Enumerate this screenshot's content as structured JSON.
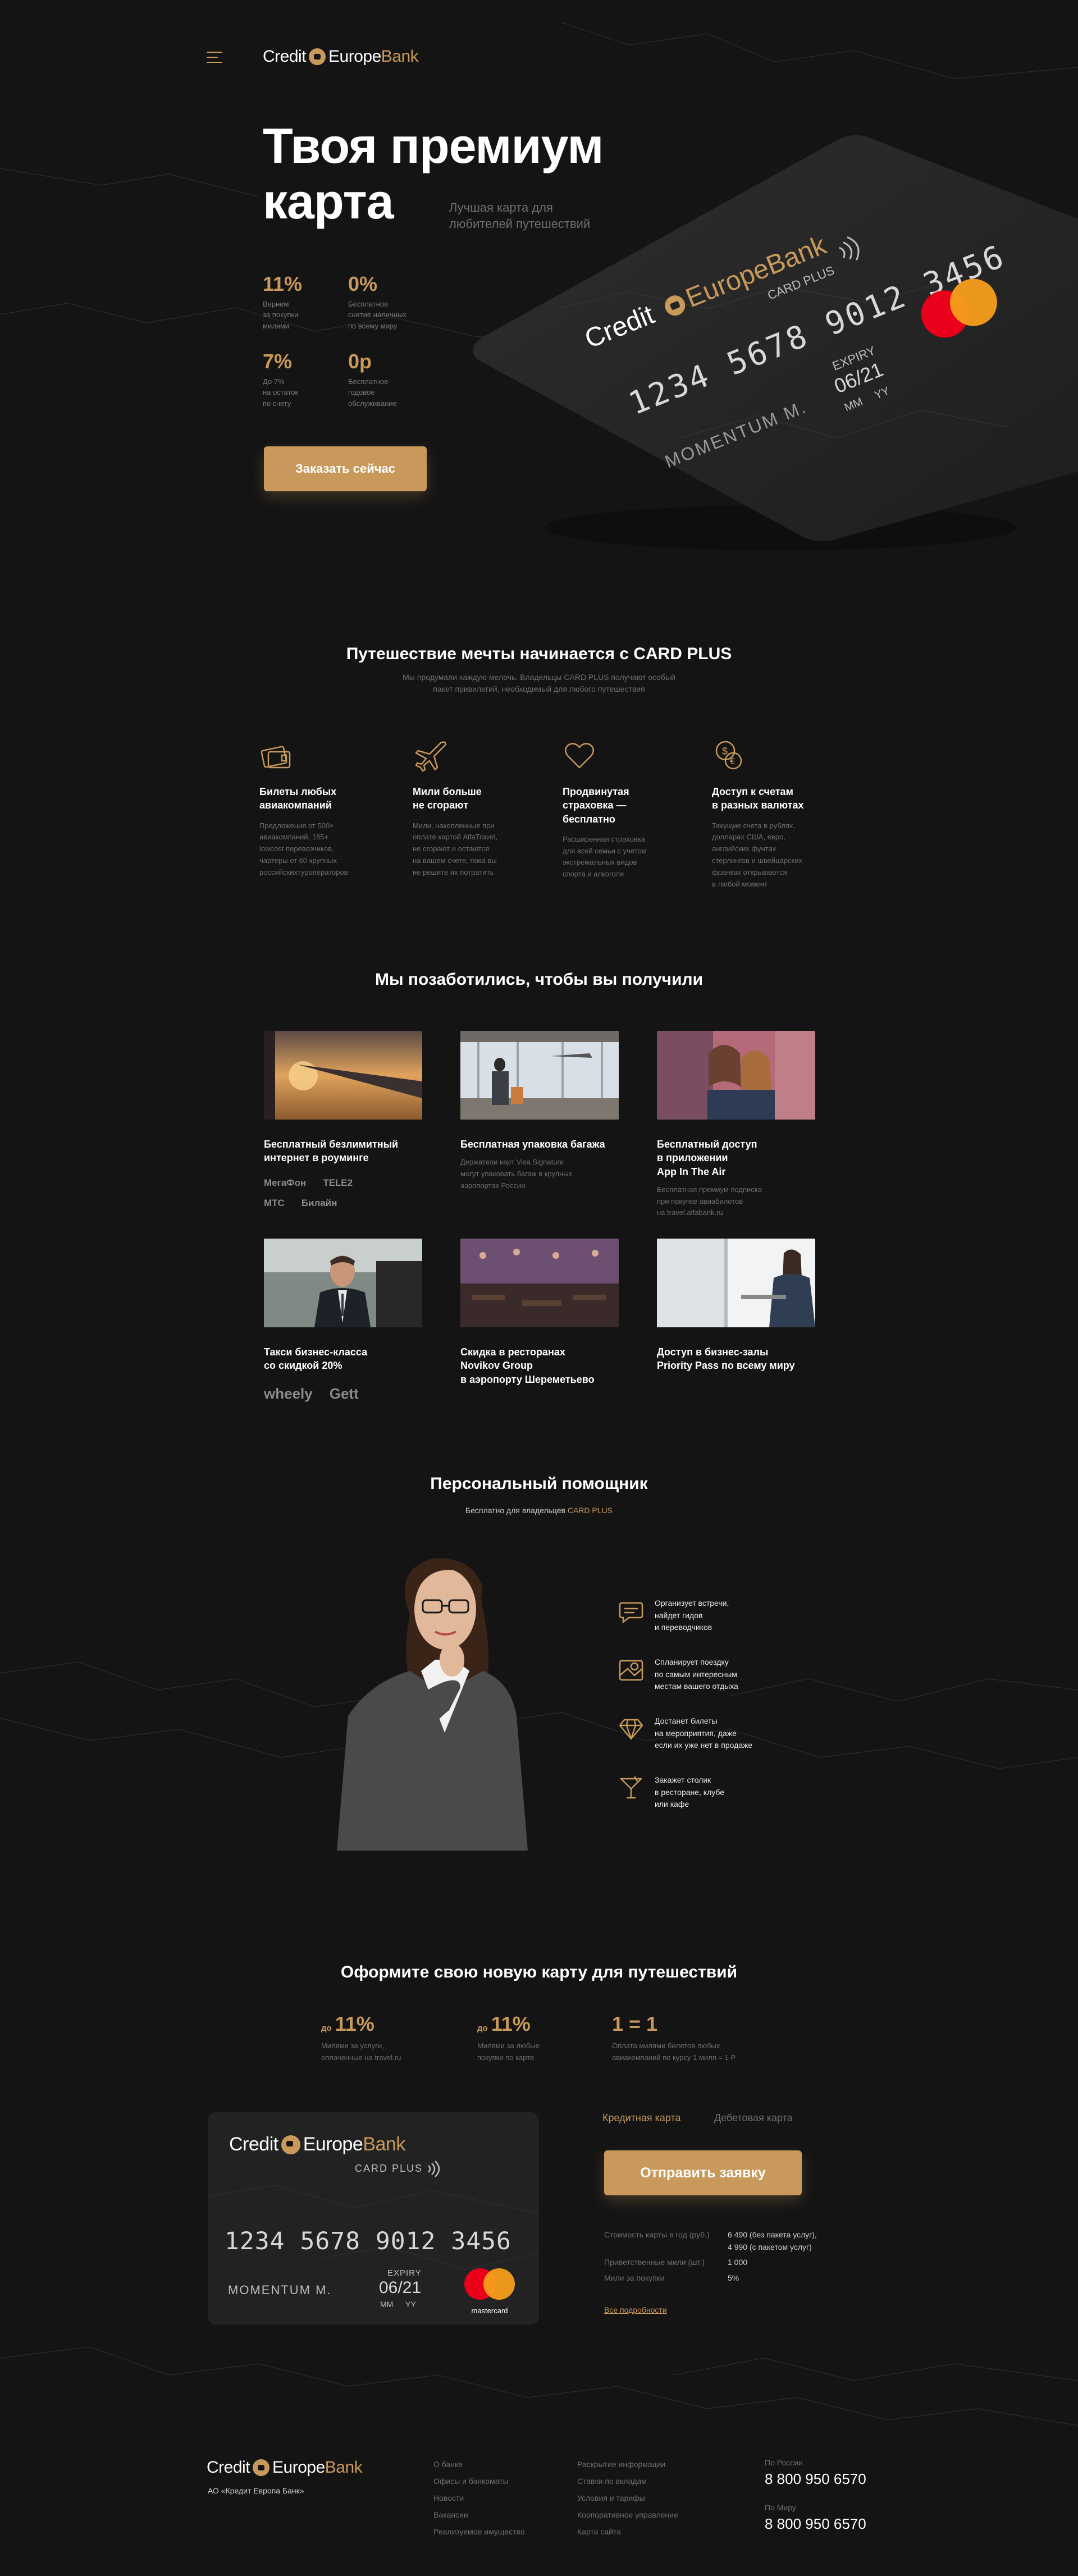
{
  "header": {
    "logo": {
      "part1": "Credit",
      "part2": "Europe",
      "part3": "Bank"
    }
  },
  "hero": {
    "title_line1": "Твоя премиум",
    "title_line2": "карта",
    "subtitle_line1": "Лучшая карта для",
    "subtitle_line2": "любителей путешествий",
    "stats": [
      {
        "value": "11%",
        "desc": [
          "Вернем",
          "за покупки",
          "милями"
        ]
      },
      {
        "value": "0%",
        "desc": [
          "Бесплатное",
          "снятие наличных",
          "по всему миру"
        ]
      },
      {
        "value": "7%",
        "desc": [
          "До 7%",
          "на остаток",
          "по счету"
        ]
      },
      {
        "value": "0р",
        "desc": [
          "Бесплатное",
          "годовое",
          "обслуживание"
        ]
      }
    ],
    "order_button": "Заказать сейчас",
    "card": {
      "brand1": "Credit",
      "brand2": "EuropeBank",
      "product": "CARD PLUS",
      "number": "1234 5678 9012 3456",
      "expiry_label": "EXPIRY",
      "expiry": "06/21",
      "expiry_mm": "MM",
      "expiry_yy": "YY",
      "holder": "MOMENTUM M."
    }
  },
  "journey": {
    "title": "Путешествие мечты начинается с CARD PLUS",
    "subtitle_line1": "Мы продумали каждую мелочь. Владельцы CARD PLUS получают особый",
    "subtitle_line2": "пакет привилегий, необходимый для любого путешествия",
    "features": [
      {
        "icon": "tickets-icon",
        "title": [
          "Билеты любых",
          "авиакомпаний"
        ],
        "desc": [
          "Предложения от 500+",
          "авиакомпаний, 185+",
          "lowcost перевозчиков,",
          "чартеры от 60 крупных",
          "российскихтуроператоров"
        ]
      },
      {
        "icon": "airplane-icon",
        "title": [
          "Мили больше",
          "не сгорают"
        ],
        "desc": [
          "Мили, накопленные при",
          "оплате картой AlfaTravel,",
          "не сгорают и остаются",
          "на вашем счете, пока вы",
          "не решите их потратить"
        ]
      },
      {
        "icon": "heart-icon",
        "title": [
          "Продвинутая",
          "страховка —",
          "бесплатно"
        ],
        "desc": [
          "Расширенная страховка",
          "для всей семьи с учетом",
          "экстремальных видов",
          "спорта и алкоголя"
        ]
      },
      {
        "icon": "coins-icon",
        "title": [
          "Доступ к счетам",
          "в разных валютах"
        ],
        "desc": [
          "Текущие счета в рублях,",
          "долларах США, евро,",
          "английских фунтах",
          "стерлингов и швейцарских",
          "франках открываются",
          "в любой момент"
        ]
      }
    ]
  },
  "benefits": {
    "title": "Мы позаботились, чтобы вы получили",
    "items": [
      {
        "photo": "airplane-wing-photo",
        "title": [
          "Бесплатный безлимитный",
          "интернет в роуминге"
        ],
        "desc": [],
        "partners": [
          "МегаФон",
          "TELE2",
          "МТС",
          "Билайн"
        ]
      },
      {
        "photo": "airport-traveler-photo",
        "title": [
          "Бесплатная упаковка багажа"
        ],
        "desc": [
          "Держатели карт Visa Signature",
          "могут упаковать багаж в крупных",
          "аэропортах России"
        ],
        "partners": []
      },
      {
        "photo": "women-selfie-photo",
        "title": [
          "Бесплатный доступ",
          "в приложении",
          "App In The Air"
        ],
        "desc": [
          "Бесплатная премиум подписка",
          "при покупке авиабилетов",
          "на travel.alfabank.ru"
        ],
        "partners": []
      },
      {
        "photo": "businessman-car-photo",
        "title": [
          "Такси бизнес-класса",
          "со скидкой 20%"
        ],
        "desc": [],
        "partners": [
          "wheely",
          "Gett"
        ]
      },
      {
        "photo": "restaurant-photo",
        "title": [
          "Скидка в ресторанах",
          "Novikov Group",
          "в аэропорту Шереметьево"
        ],
        "desc": [],
        "partners": []
      },
      {
        "photo": "business-lounge-photo",
        "title": [
          "Доступ в бизнес-залы",
          "Priority Pass по всему миру"
        ],
        "desc": [],
        "partners": []
      }
    ]
  },
  "assistant": {
    "title": "Персональный помощник",
    "subtitle_prefix": "Бесплатно для владельцев ",
    "subtitle_highlight": "CARD PLUS",
    "items": [
      {
        "icon": "chat-icon",
        "text": [
          "Организует встречи,",
          "найдет гидов",
          "и переводчиков"
        ]
      },
      {
        "icon": "map-pin-icon",
        "text": [
          "Спланирует поездку",
          "по самым интересным",
          "местам вашего отдыха"
        ]
      },
      {
        "icon": "diamond-icon",
        "text": [
          "Достанет билеты",
          "на мероприятия, даже",
          "если их уже нет в продаже"
        ]
      },
      {
        "icon": "cocktail-icon",
        "text": [
          "Закажет столик",
          "в ресторане, клубе",
          "или кафе"
        ]
      }
    ]
  },
  "apply": {
    "title": "Оформите свою новую карту для путешествий",
    "stats": [
      {
        "prefix": "до",
        "value": "11%",
        "desc": [
          "Милями за услуги,",
          "оплаченные на travel.ru"
        ]
      },
      {
        "prefix": "до",
        "value": "11%",
        "desc": [
          "Милями за любые",
          "покупки по карте"
        ]
      },
      {
        "prefix": "",
        "value": "1 = 1",
        "desc": [
          "Оплата милями билетов любых",
          "авиакомпаний по курсу 1 миля = 1 Р"
        ]
      }
    ],
    "card": {
      "brand1": "Credit",
      "brand2": "Europe",
      "brand3": "Bank",
      "product": "CARD PLUS",
      "number": "1234 5678 9012 3456",
      "expiry_label": "EXPIRY",
      "expiry": "06/21",
      "expiry_mm": "MM",
      "expiry_yy": "YY",
      "holder": "MOMENTUM M.",
      "network": "mastercard"
    },
    "tabs": [
      "Кредитная карта",
      "Дебетовая карта"
    ],
    "active_tab": "Кредитная карта",
    "button": "Отправить заявку",
    "specs": [
      {
        "label": "Стоимость карты в год (руб.)",
        "value": [
          "6 490 (без пакета услуг),",
          "4 990 (с пакетом услуг)"
        ]
      },
      {
        "label": "Приветственные мили (шт.)",
        "value": [
          "1 000"
        ]
      },
      {
        "label": "Мили за покупки",
        "value": [
          "5%"
        ]
      }
    ],
    "details_link": "Все подробности"
  },
  "footer": {
    "logo": {
      "part1": "Credit",
      "part2": "Europe",
      "part3": "Bank"
    },
    "company": "АО «Кредит Европа Банк»",
    "col1": [
      "О банке",
      "Офисы и банкоматы",
      "Новости",
      "Вакансии",
      "Реализуемое имущество"
    ],
    "col2": [
      "Раскрытие информации",
      "Ставки по вкладам",
      "Условия и тарифы",
      "Корпоративное управление",
      "Карта сайта"
    ],
    "phones": [
      {
        "label": "По России",
        "number": "8 800 950 6570"
      },
      {
        "label": "По Миру",
        "number": "8 800 950 6570"
      }
    ]
  },
  "colors": {
    "background": "#141414",
    "accent": "#c8995a",
    "muted": "#6e6e6e",
    "card": "#222222"
  }
}
